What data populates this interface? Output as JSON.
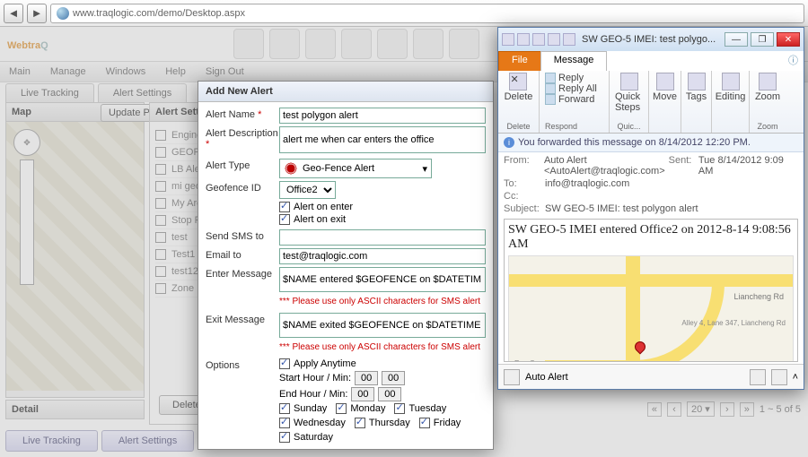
{
  "browser": {
    "url": "www.traqlogic.com/demo/Desktop.aspx"
  },
  "brand": {
    "part1": "Webtra",
    "part2": "Q"
  },
  "menu": [
    "Main",
    "Manage",
    "Windows",
    "Help",
    "Sign Out"
  ],
  "upperTabs": {
    "live": "Live Tracking",
    "alerts": "Alert Settings"
  },
  "map": {
    "header": "Map",
    "updateBtn": "Update P",
    "detail": "Detail"
  },
  "alertsPanel": {
    "header": "Alert Settings",
    "rows": [
      "Engine",
      "GEOFE",
      "LB Ale",
      "mi geo",
      "My Are",
      "Stop R",
      "test",
      "Test1",
      "test12",
      "Zone"
    ],
    "deleteBtn": "Delete"
  },
  "pager": {
    "pageSize": "20",
    "range": "1 ~ 5 of 5"
  },
  "bottomTabs": [
    "Live Tracking",
    "Alert Settings"
  ],
  "modal": {
    "title": "Add New Alert",
    "labels": {
      "name": "Alert Name",
      "desc": "Alert Description",
      "type": "Alert Type",
      "geoId": "Geofence ID",
      "onEnter": "Alert on enter",
      "onExit": "Alert on exit",
      "sms": "Send SMS to",
      "email": "Email to",
      "enterMsg": "Enter Message",
      "exitMsg": "Exit Message",
      "options": "Options",
      "applyAny": "Apply Anytime",
      "startHM": "Start Hour / Min:",
      "endHM": "End Hour / Min:"
    },
    "values": {
      "name": "test polygon alert",
      "desc": "alert me when car enters the office",
      "type": "Geo-Fence Alert",
      "geoId": "Office2",
      "email": "test@traqlogic.com",
      "enterMsg": "$NAME entered $GEOFENCE on $DATETIME",
      "exitMsg": "$NAME exited $GEOFENCE on $DATETIME",
      "zero": "00"
    },
    "hint": "*** Please use only ASCII characters for SMS alert",
    "days": [
      "Sunday",
      "Monday",
      "Tuesday",
      "Wednesday",
      "Thursday",
      "Friday",
      "Saturday"
    ]
  },
  "outlook": {
    "title": "SW GEO-5 IMEI: test polygo...",
    "tabs": {
      "file": "File",
      "message": "Message"
    },
    "ribbon": {
      "delete": "Delete",
      "reply": "Reply",
      "replyAll": "Reply All",
      "forward": "Forward",
      "respond": "Respond",
      "quickSteps": "Quick Steps",
      "quick": "Quic...",
      "move": "Move",
      "tags": "Tags",
      "editing": "Editing",
      "zoom": "Zoom"
    },
    "info": "You forwarded this message on 8/14/2012 12:20 PM.",
    "headers": {
      "fromLbl": "From:",
      "fromVal": "Auto Alert <AutoAlert@traqlogic.com>",
      "sentLbl": "Sent:",
      "sentVal": "Tue 8/14/2012 9:09 AM",
      "toLbl": "To:",
      "toVal": "info@traqlogic.com",
      "ccLbl": "Cc:",
      "subjLbl": "Subject:",
      "subjVal": "SW GEO-5 IMEI: test polygon alert"
    },
    "bodyTitle": "SW GEO-5 IMEI entered Office2 on 2012-8-14 9:08:56 AM",
    "roads": {
      "r1": "Liancheng Rd",
      "r2": "Alley 4, Lane 347, Liancheng Rd",
      "r3": "Run Cao"
    },
    "fromBar": "Auto Alert"
  }
}
